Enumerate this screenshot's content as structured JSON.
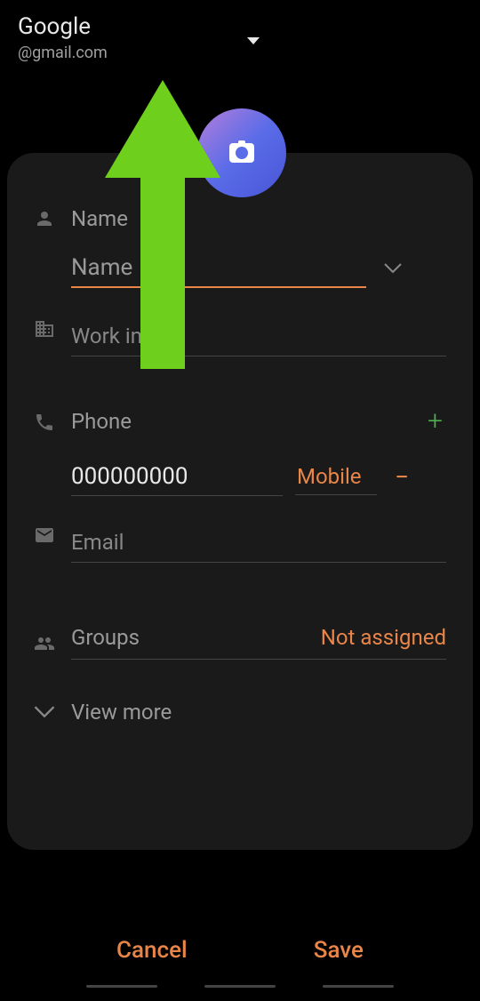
{
  "header": {
    "account_label": "Google",
    "account_email": "@gmail.com"
  },
  "form": {
    "name": {
      "label": "Name",
      "placeholder": "Name",
      "value": ""
    },
    "work": {
      "label": "Work info",
      "value": ""
    },
    "phone": {
      "label": "Phone",
      "number": "000000000",
      "type": "Mobile"
    },
    "email": {
      "label": "Email",
      "value": ""
    },
    "groups": {
      "label": "Groups",
      "value": "Not assigned"
    },
    "view_more": "View more"
  },
  "buttons": {
    "cancel": "Cancel",
    "save": "Save"
  },
  "colors": {
    "accent": "#e88548",
    "green": "#4caf50"
  }
}
